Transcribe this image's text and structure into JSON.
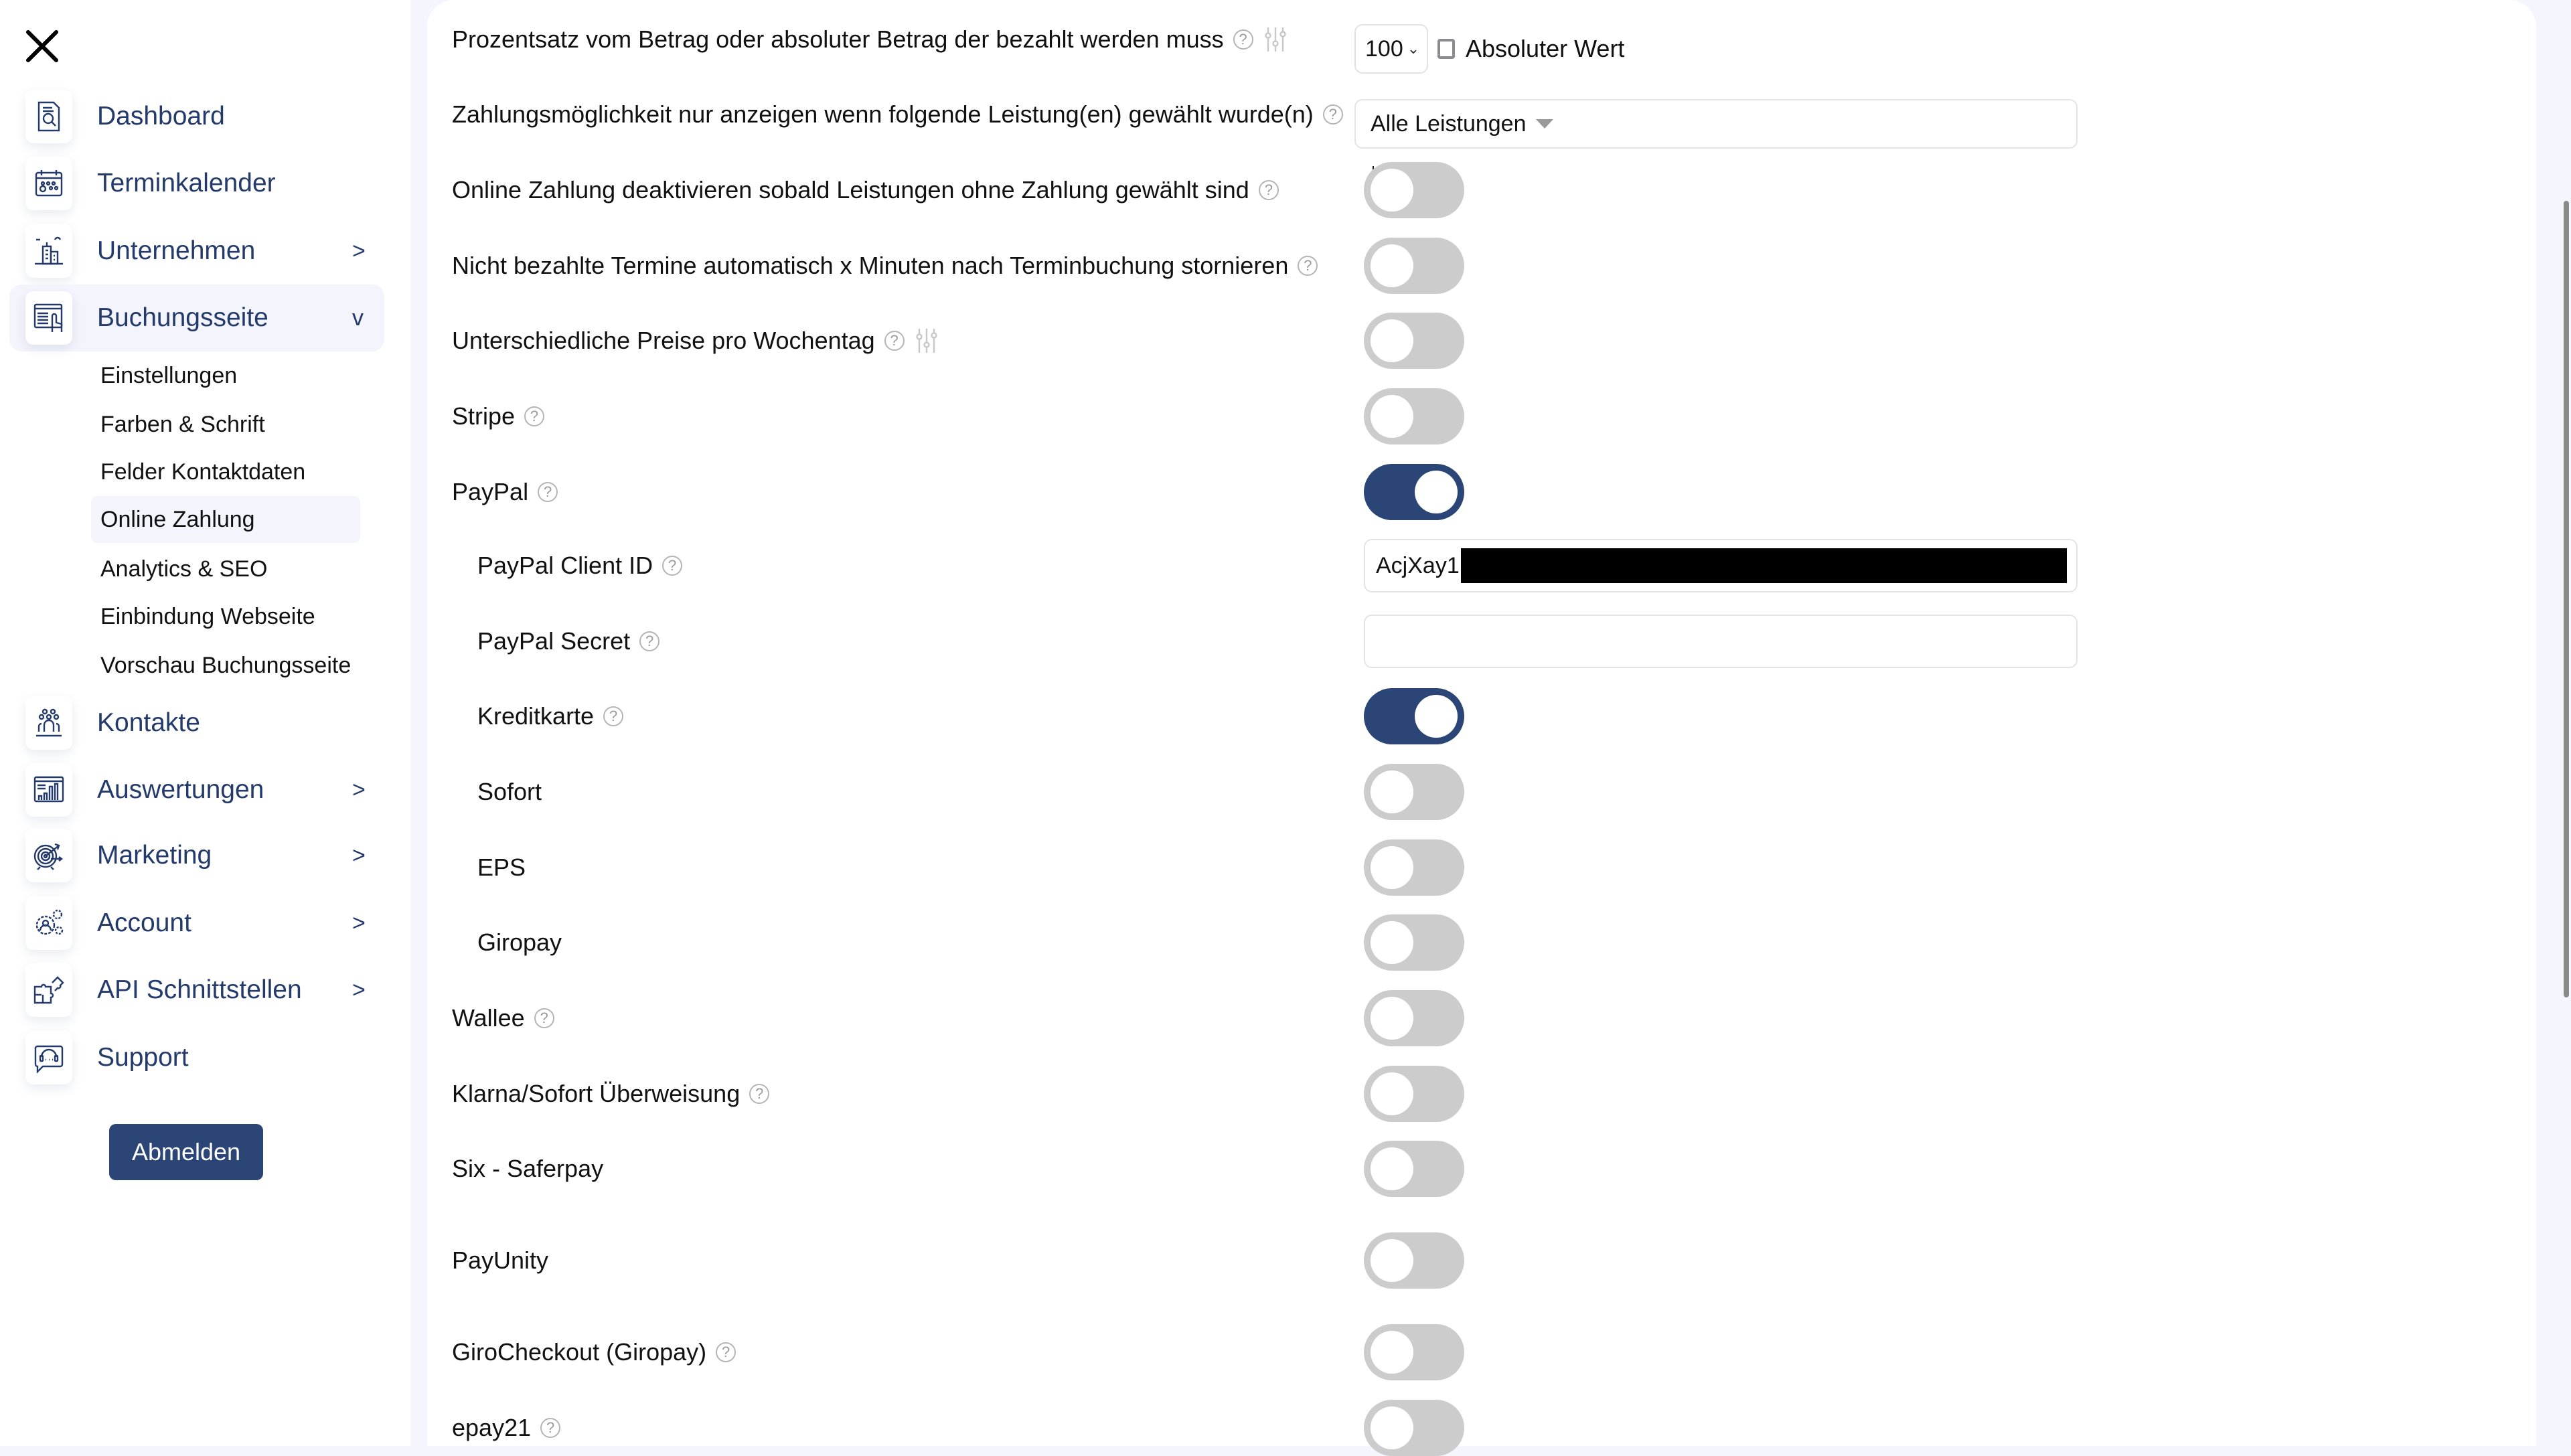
{
  "sidebar": {
    "close_icon": "close-icon",
    "items": [
      {
        "label": "Dashboard",
        "icon": "dashboard-icon",
        "chevron": ""
      },
      {
        "label": "Terminkalender",
        "icon": "calendar-icon",
        "chevron": ""
      },
      {
        "label": "Unternehmen",
        "icon": "building-icon",
        "chevron": ">"
      },
      {
        "label": "Buchungsseite",
        "icon": "booking-page-icon",
        "chevron": "v"
      },
      {
        "label": "Kontakte",
        "icon": "contacts-icon",
        "chevron": ""
      },
      {
        "label": "Auswertungen",
        "icon": "analytics-icon",
        "chevron": ">"
      },
      {
        "label": "Marketing",
        "icon": "target-icon",
        "chevron": ">"
      },
      {
        "label": "Account",
        "icon": "gears-icon",
        "chevron": ">"
      },
      {
        "label": "API Schnittstellen",
        "icon": "puzzle-icon",
        "chevron": ">"
      },
      {
        "label": "Support",
        "icon": "support-icon",
        "chevron": ""
      }
    ],
    "subitems": [
      {
        "label": "Einstellungen"
      },
      {
        "label": "Farben & Schrift"
      },
      {
        "label": "Felder Kontaktdaten"
      },
      {
        "label": "Online Zahlung"
      },
      {
        "label": "Analytics & SEO"
      },
      {
        "label": "Einbindung Webseite"
      },
      {
        "label": "Vorschau Buchungsseite"
      }
    ],
    "active_item": "Buchungsseite",
    "active_subitem": "Online Zahlung",
    "logout_label": "Abmelden"
  },
  "settings": {
    "amount": {
      "label": "Prozentsatz vom Betrag oder absoluter Betrag der bezahlt werden muss",
      "select_value": "100",
      "checkbox_label": "Absoluter Wert",
      "checkbox_checked": false
    },
    "services_filter": {
      "label": "Zahlungsmöglichkeit nur anzeigen wenn folgende Leistung(en) gewählt wurde(n)",
      "value": "Alle Leistungen"
    },
    "rows": [
      {
        "label": "Online Zahlung deaktivieren sobald Leistungen ohne Zahlung gewählt sind",
        "help": true,
        "sliders": false,
        "on": false,
        "indent": false
      },
      {
        "label": "Nicht bezahlte Termine automatisch x Minuten nach Terminbuchung stornieren",
        "help": true,
        "sliders": false,
        "on": false,
        "indent": false
      },
      {
        "label": "Unterschiedliche Preise pro Wochentag",
        "help": true,
        "sliders": true,
        "on": false,
        "indent": false
      },
      {
        "label": "Stripe",
        "help": true,
        "sliders": false,
        "on": false,
        "indent": false
      },
      {
        "label": "PayPal",
        "help": true,
        "sliders": false,
        "on": true,
        "indent": false
      }
    ],
    "paypal_client_id": {
      "label": "PayPal Client ID",
      "value_visible": "AcjXay1",
      "redacted": true
    },
    "paypal_secret": {
      "label": "PayPal Secret",
      "value": ""
    },
    "rows2": [
      {
        "label": "Kreditkarte",
        "help": true,
        "on": true,
        "indent": true
      },
      {
        "label": "Sofort",
        "help": false,
        "on": false,
        "indent": true
      },
      {
        "label": "EPS",
        "help": false,
        "on": false,
        "indent": true
      },
      {
        "label": "Giropay",
        "help": false,
        "on": false,
        "indent": true
      },
      {
        "label": "Wallee",
        "help": true,
        "on": false,
        "indent": false
      },
      {
        "label": "Klarna/Sofort Überweisung",
        "help": true,
        "on": false,
        "indent": false
      },
      {
        "label": "Six - Saferpay",
        "help": false,
        "on": false,
        "indent": false
      },
      {
        "label": "PayUnity",
        "help": false,
        "on": false,
        "indent": false
      },
      {
        "label": "GiroCheckout (Giropay)",
        "help": true,
        "on": false,
        "indent": false
      },
      {
        "label": "epay21",
        "help": true,
        "on": false,
        "indent": false
      }
    ],
    "help_glyph": "?"
  },
  "colors": {
    "brand": "#2a4576",
    "toggle_off": "#cccccc",
    "background": "#f5f6fd",
    "nav_text": "#233a6b"
  }
}
